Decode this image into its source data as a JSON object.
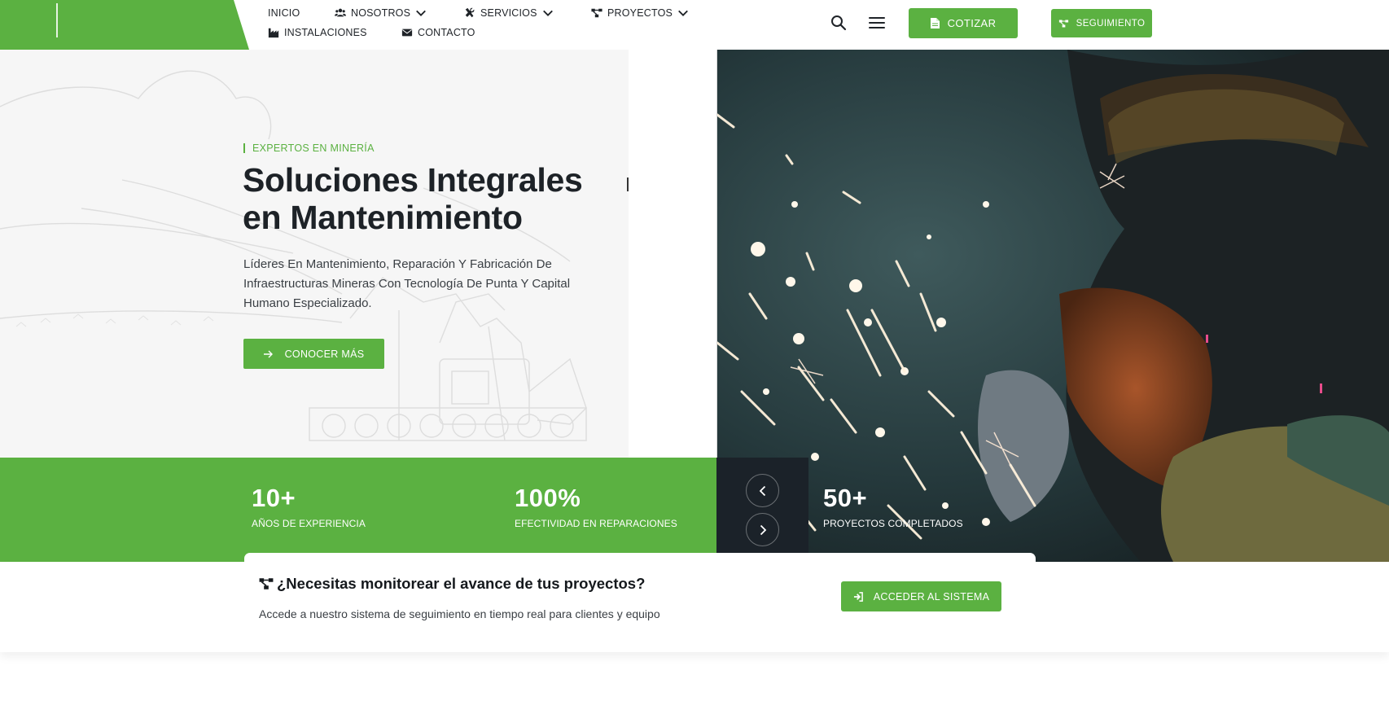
{
  "header": {
    "nav": [
      {
        "label": "INICIO",
        "icon": ""
      },
      {
        "label": "NOSOTROS",
        "icon": "users-icon",
        "has_dropdown": true
      },
      {
        "label": "SERVICIOS",
        "icon": "tools-icon",
        "has_dropdown": true
      },
      {
        "label": "PROYECTOS",
        "icon": "project-diagram-icon",
        "has_dropdown": true
      },
      {
        "label": "INSTALACIONES",
        "icon": "industry-icon"
      },
      {
        "label": "CONTACTO",
        "icon": "envelope-icon"
      }
    ],
    "cotizar_label": "COTIZAR",
    "seguimiento_label": "SEGUIMIENTO"
  },
  "hero": {
    "eyebrow": "EXPERTOS EN MINERÍA",
    "title_line1": "Soluciones Integrales",
    "title_line2": "en Mantenimiento",
    "description": "Líderes En Mantenimiento, Reparación Y Fabricación De Infraestructuras Mineras Con Tecnología De Punta Y Capital Humano Especializado.",
    "cta_label": "CONOCER MÁS"
  },
  "stats": [
    {
      "value": "10+",
      "label": "AÑOS DE EXPERIENCIA"
    },
    {
      "value": "100%",
      "label": "EFECTIVIDAD EN REPARACIONES"
    },
    {
      "value": "50+",
      "label": "PROYECTOS COMPLETADOS"
    }
  ],
  "monitor": {
    "title": "¿Necesitas monitorear el avance de tus proyectos?",
    "subtitle": "Accede a nuestro sistema de seguimiento en tiempo real para clientes y equipo",
    "button_label": "ACCEDER AL SISTEMA"
  },
  "colors": {
    "brand_green": "#5bb141",
    "dark": "#1b2229",
    "light_bg": "#f6f6f6"
  }
}
